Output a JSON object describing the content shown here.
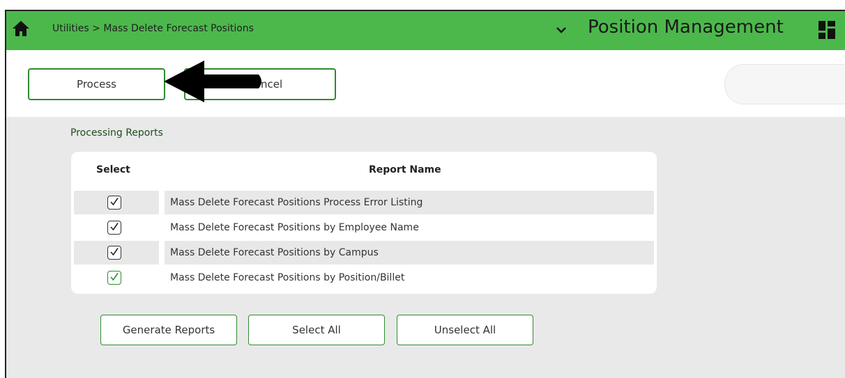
{
  "header": {
    "breadcrumb": "Utilities > Mass Delete Forecast Positions",
    "app_title": "Position Management"
  },
  "actions": {
    "process_label": "Process",
    "cancel_label": "ncel"
  },
  "section": {
    "title": "Processing Reports"
  },
  "reports_table": {
    "columns": [
      "Select",
      "Report Name"
    ],
    "rows": [
      {
        "checked": true,
        "name": "Mass Delete Forecast Positions Process Error Listing"
      },
      {
        "checked": true,
        "name": "Mass Delete Forecast Positions by Employee Name"
      },
      {
        "checked": true,
        "name": "Mass Delete Forecast Positions by Campus"
      },
      {
        "checked": true,
        "name": "Mass Delete Forecast Positions by Position/Billet"
      }
    ]
  },
  "footer_buttons": {
    "generate": "Generate Reports",
    "select_all": "Select All",
    "unselect_all": "Unselect All"
  },
  "colors": {
    "header_green": "#4cb84c",
    "button_border": "#2e8b2e",
    "content_bg": "#e9e9e9"
  },
  "icons": [
    "home-icon",
    "chevron-down-icon",
    "grid-icon",
    "arrow-annotation",
    "check-icon"
  ]
}
